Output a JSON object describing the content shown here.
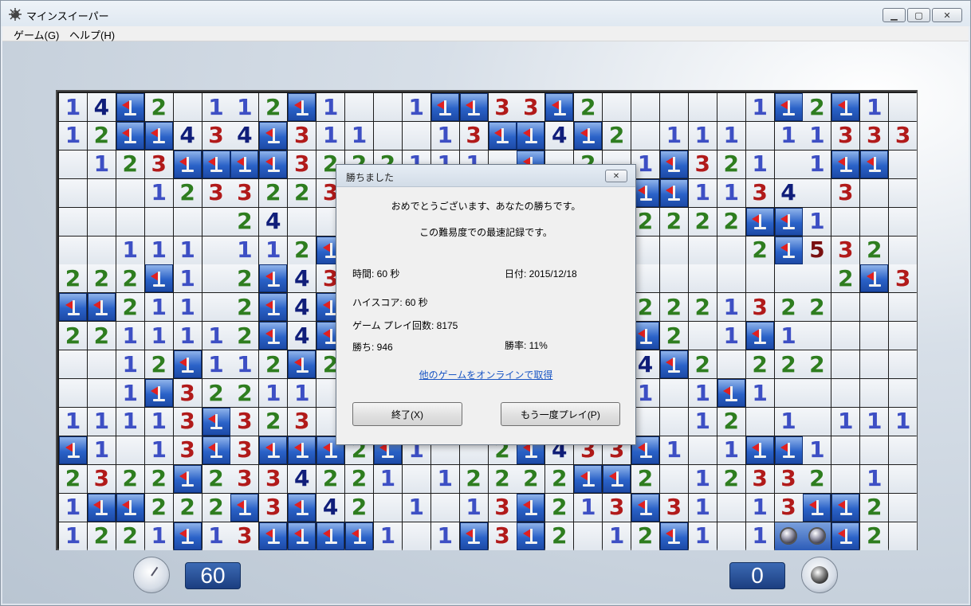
{
  "window": {
    "title": "マインスイーパー",
    "min": "▁",
    "max": "▢",
    "close": "✕"
  },
  "menu": {
    "game": "ゲーム(G)",
    "help": "ヘルプ(H)"
  },
  "board": {
    "rows": [
      "14F2.112F1..1FF33F2.....1F2F1",
      "12FF434F311..13FF4F2.111.113333",
      ".123FFFF3222111-F-2.1F321.1FF",
      "...1233223......1122FF1134 3",
      "......24........F1122222FF1",
      "..111.112F......11......2F532",
      "222F1.2F43.................2F3F1",
      "FF211.2F4F.......1122221322",
      "2211112F4F......1F3FF2.1F1",
      "..12F112F21......12F4F2.222",
      "..1F32211........1121.1F1",
      "11113F323 2...........12.1.111",
      "F1.13F3FFF2F1..2F433F1.1FF1....",
      "2322F2334221.12222FF2.12332 1..",
      "1FF222F3F42.1.13F213F31.13FF2..",
      "1221F13FFFF1.1F3F2.12F1.1MMF2.."
    ]
  },
  "counters": {
    "time": "60",
    "mines": "0"
  },
  "dialog": {
    "title": "勝ちました",
    "close": "✕",
    "congrats": "おめでとうございます、あなたの勝ちです。",
    "record": "この難易度での最速記録です。",
    "time": "時間: 60 秒",
    "date": "日付: 2015/12/18",
    "highscore": "ハイスコア: 60 秒",
    "games_played": "ゲーム プレイ回数: 8175",
    "wins": "勝ち: 946",
    "win_rate": "勝率: 11%",
    "link": "他のゲームをオンラインで取得",
    "exit": "終了(X)",
    "play_again": "もう一度プレイ(P)"
  }
}
